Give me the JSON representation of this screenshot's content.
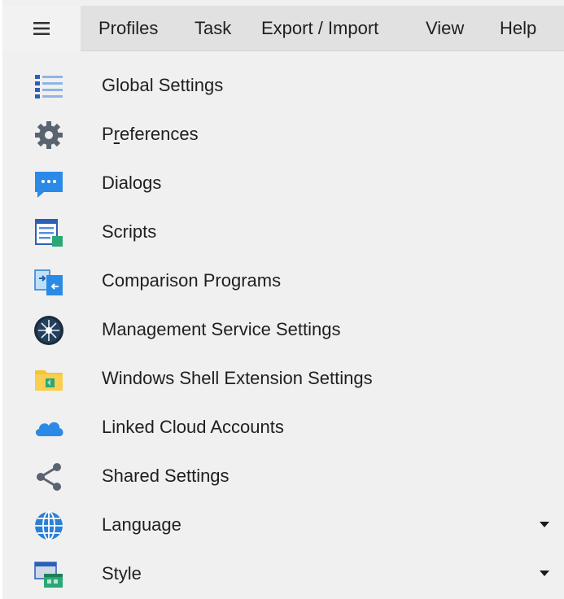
{
  "menubar": {
    "menu_icon": "hamburger-icon",
    "items": [
      "Profiles",
      "Task",
      "Export / Import",
      "View",
      "Help"
    ]
  },
  "menu": {
    "items": [
      {
        "label_pre": "Global Settings",
        "label_u": "",
        "label_post": "",
        "icon": "list-icon"
      },
      {
        "label_pre": "P",
        "label_u": "r",
        "label_post": "eferences",
        "icon": "gear-icon"
      },
      {
        "label_pre": "Dialogs",
        "label_u": "",
        "label_post": "",
        "icon": "chat-bubble-icon"
      },
      {
        "label_pre": "Scripts",
        "label_u": "",
        "label_post": "",
        "icon": "script-icon"
      },
      {
        "label_pre": "Comparison Programs",
        "label_u": "",
        "label_post": "",
        "icon": "compare-icon"
      },
      {
        "label_pre": "Management Service Settings",
        "label_u": "",
        "label_post": "",
        "icon": "service-icon"
      },
      {
        "label_pre": "Windows Shell Extension Settings",
        "label_u": "",
        "label_post": "",
        "icon": "folder-icon"
      },
      {
        "label_pre": "Linked Cloud Accounts",
        "label_u": "",
        "label_post": "",
        "icon": "cloud-icon"
      },
      {
        "label_pre": "Shared Settings",
        "label_u": "",
        "label_post": "",
        "icon": "share-icon"
      },
      {
        "label_pre": "Language",
        "label_u": "",
        "label_post": "",
        "icon": "globe-icon",
        "submenu": true
      },
      {
        "label_pre": "Style",
        "label_u": "",
        "label_post": "",
        "icon": "style-icon",
        "submenu": true
      }
    ]
  },
  "colors": {
    "menubar_bg": "#e1e1e1",
    "menu_bg": "#f0f0f0",
    "accent_blue": "#2b7fd4",
    "icon_gray": "#5a6470"
  }
}
